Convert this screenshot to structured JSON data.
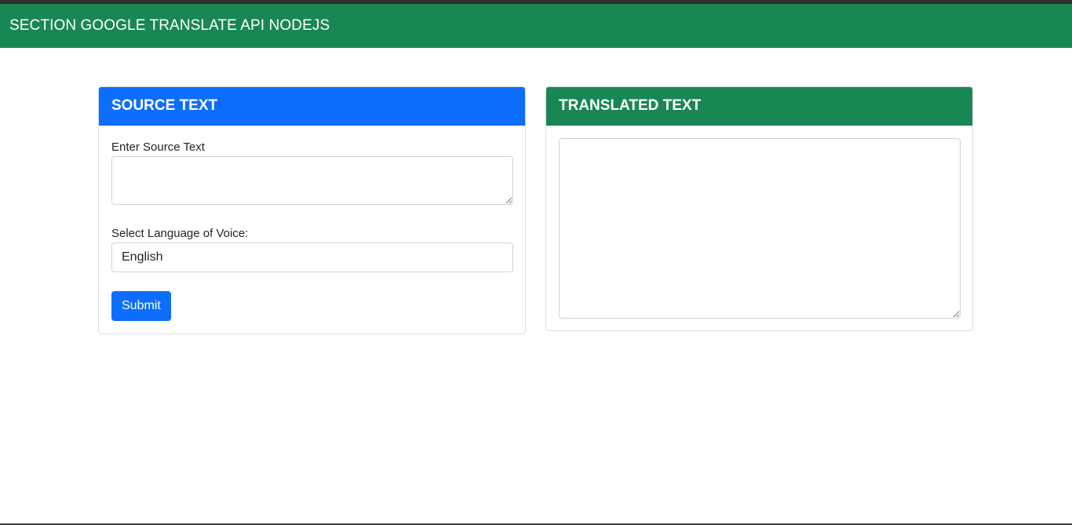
{
  "navbar": {
    "title": "SECTION GOOGLE TRANSLATE API NODEJS"
  },
  "source_card": {
    "header": "SOURCE TEXT",
    "input_label": "Enter Source Text",
    "input_value": "",
    "language_label": "Select Language of Voice:",
    "language_selected": "English",
    "submit_label": "Submit"
  },
  "translated_card": {
    "header": "TRANSLATED TEXT",
    "output_value": ""
  },
  "colors": {
    "navbar": "#198754",
    "source_header": "#0d6efd",
    "translated_header": "#198754",
    "submit_button": "#0d6efd"
  }
}
